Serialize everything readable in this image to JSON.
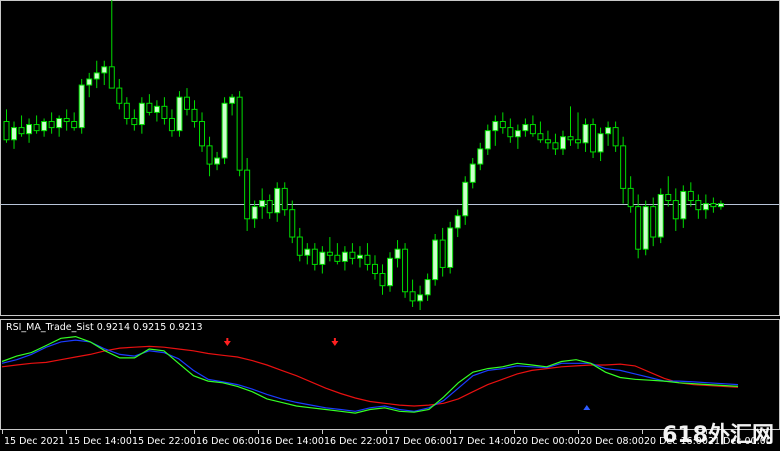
{
  "chart_data": [
    {
      "type": "candlestick",
      "title": "",
      "colors": {
        "background": "#000000",
        "bull": "#ccffcc",
        "bear": "#000000",
        "wick": "#00dd00",
        "grid_line": "#b8c4d8",
        "frame": "#c8c8c8"
      },
      "ylim": [
        0.0,
        1.0
      ],
      "reference_line_value": 0.35,
      "candles": [
        [
          0.62,
          0.66,
          0.55,
          0.56
        ],
        [
          0.56,
          0.62,
          0.53,
          0.6
        ],
        [
          0.6,
          0.64,
          0.57,
          0.58
        ],
        [
          0.58,
          0.63,
          0.55,
          0.61
        ],
        [
          0.61,
          0.64,
          0.58,
          0.59
        ],
        [
          0.59,
          0.63,
          0.57,
          0.62
        ],
        [
          0.62,
          0.65,
          0.58,
          0.6
        ],
        [
          0.6,
          0.64,
          0.57,
          0.63
        ],
        [
          0.63,
          0.66,
          0.59,
          0.62
        ],
        [
          0.62,
          0.65,
          0.59,
          0.6
        ],
        [
          0.6,
          0.76,
          0.58,
          0.74
        ],
        [
          0.74,
          0.78,
          0.7,
          0.76
        ],
        [
          0.76,
          0.82,
          0.73,
          0.78
        ],
        [
          0.78,
          0.82,
          0.74,
          0.8
        ],
        [
          0.8,
          1.02,
          0.77,
          0.73
        ],
        [
          0.73,
          0.76,
          0.66,
          0.68
        ],
        [
          0.68,
          0.7,
          0.61,
          0.63
        ],
        [
          0.63,
          0.66,
          0.59,
          0.61
        ],
        [
          0.61,
          0.7,
          0.58,
          0.68
        ],
        [
          0.68,
          0.71,
          0.64,
          0.65
        ],
        [
          0.65,
          0.69,
          0.62,
          0.67
        ],
        [
          0.67,
          0.7,
          0.61,
          0.63
        ],
        [
          0.63,
          0.66,
          0.57,
          0.59
        ],
        [
          0.59,
          0.72,
          0.57,
          0.7
        ],
        [
          0.7,
          0.73,
          0.64,
          0.66
        ],
        [
          0.66,
          0.69,
          0.6,
          0.62
        ],
        [
          0.62,
          0.65,
          0.52,
          0.54
        ],
        [
          0.54,
          0.57,
          0.44,
          0.48
        ],
        [
          0.48,
          0.52,
          0.46,
          0.5
        ],
        [
          0.5,
          0.7,
          0.48,
          0.68
        ],
        [
          0.68,
          0.71,
          0.64,
          0.7
        ],
        [
          0.7,
          0.72,
          0.44,
          0.46
        ],
        [
          0.46,
          0.5,
          0.26,
          0.3
        ],
        [
          0.3,
          0.36,
          0.27,
          0.34
        ],
        [
          0.34,
          0.4,
          0.3,
          0.36
        ],
        [
          0.36,
          0.38,
          0.3,
          0.32
        ],
        [
          0.32,
          0.42,
          0.29,
          0.4
        ],
        [
          0.4,
          0.42,
          0.31,
          0.33
        ],
        [
          0.33,
          0.36,
          0.22,
          0.24
        ],
        [
          0.24,
          0.27,
          0.16,
          0.18
        ],
        [
          0.18,
          0.22,
          0.15,
          0.2
        ],
        [
          0.2,
          0.22,
          0.13,
          0.15
        ],
        [
          0.15,
          0.21,
          0.12,
          0.19
        ],
        [
          0.19,
          0.24,
          0.16,
          0.18
        ],
        [
          0.18,
          0.22,
          0.15,
          0.16
        ],
        [
          0.16,
          0.21,
          0.13,
          0.19
        ],
        [
          0.19,
          0.22,
          0.15,
          0.17
        ],
        [
          0.17,
          0.21,
          0.14,
          0.18
        ],
        [
          0.18,
          0.22,
          0.13,
          0.15
        ],
        [
          0.15,
          0.18,
          0.1,
          0.12
        ],
        [
          0.12,
          0.15,
          0.05,
          0.08
        ],
        [
          0.08,
          0.19,
          0.06,
          0.17
        ],
        [
          0.17,
          0.23,
          0.14,
          0.2
        ],
        [
          0.2,
          0.22,
          0.04,
          0.06
        ],
        [
          0.06,
          0.1,
          0.01,
          0.03
        ],
        [
          0.03,
          0.08,
          0.0,
          0.05
        ],
        [
          0.05,
          0.12,
          0.03,
          0.1
        ],
        [
          0.1,
          0.25,
          0.08,
          0.23
        ],
        [
          0.23,
          0.27,
          0.11,
          0.14
        ],
        [
          0.14,
          0.29,
          0.12,
          0.27
        ],
        [
          0.27,
          0.33,
          0.24,
          0.31
        ],
        [
          0.31,
          0.44,
          0.28,
          0.42
        ],
        [
          0.42,
          0.5,
          0.4,
          0.48
        ],
        [
          0.48,
          0.55,
          0.46,
          0.53
        ],
        [
          0.53,
          0.61,
          0.51,
          0.59
        ],
        [
          0.59,
          0.64,
          0.54,
          0.62
        ],
        [
          0.62,
          0.65,
          0.58,
          0.6
        ],
        [
          0.6,
          0.63,
          0.55,
          0.57
        ],
        [
          0.57,
          0.61,
          0.53,
          0.59
        ],
        [
          0.59,
          0.63,
          0.57,
          0.61
        ],
        [
          0.61,
          0.64,
          0.57,
          0.58
        ],
        [
          0.58,
          0.62,
          0.55,
          0.56
        ],
        [
          0.56,
          0.59,
          0.53,
          0.55
        ],
        [
          0.55,
          0.58,
          0.51,
          0.53
        ],
        [
          0.53,
          0.59,
          0.51,
          0.57
        ],
        [
          0.57,
          0.67,
          0.54,
          0.56
        ],
        [
          0.56,
          0.65,
          0.53,
          0.55
        ],
        [
          0.55,
          0.63,
          0.52,
          0.61
        ],
        [
          0.61,
          0.63,
          0.5,
          0.52
        ],
        [
          0.52,
          0.6,
          0.49,
          0.58
        ],
        [
          0.58,
          0.62,
          0.54,
          0.6
        ],
        [
          0.6,
          0.62,
          0.52,
          0.54
        ],
        [
          0.54,
          0.57,
          0.35,
          0.4
        ],
        [
          0.4,
          0.44,
          0.32,
          0.34
        ],
        [
          0.34,
          0.38,
          0.17,
          0.2
        ],
        [
          0.2,
          0.36,
          0.18,
          0.34
        ],
        [
          0.34,
          0.37,
          0.21,
          0.24
        ],
        [
          0.24,
          0.4,
          0.22,
          0.38
        ],
        [
          0.38,
          0.44,
          0.34,
          0.36
        ],
        [
          0.36,
          0.4,
          0.26,
          0.3
        ],
        [
          0.3,
          0.41,
          0.27,
          0.39
        ],
        [
          0.39,
          0.42,
          0.34,
          0.36
        ],
        [
          0.36,
          0.38,
          0.3,
          0.33
        ],
        [
          0.33,
          0.38,
          0.3,
          0.35
        ],
        [
          0.35,
          0.37,
          0.32,
          0.34
        ],
        [
          0.34,
          0.36,
          0.33,
          0.35
        ]
      ]
    },
    {
      "type": "line",
      "indicator_label": "RSI_MA_Trade_Sist 0.9214 0.9215 0.9213",
      "ylim": [
        0.0,
        1.0
      ],
      "x_tick_labels": [
        "15 Dec 2021",
        "15 Dec 14:00",
        "15 Dec 22:00",
        "16 Dec 06:00",
        "16 Dec 14:00",
        "16 Dec 22:00",
        "17 Dec 06:00",
        "17 Dec 14:00",
        "20 Dec 00:00",
        "20 Dec 08:00",
        "20 Dec 16:00",
        "21 Dec 00:00"
      ],
      "series": [
        {
          "name": "",
          "color": "#e81010",
          "values": [
            0.62,
            0.64,
            0.66,
            0.67,
            0.7,
            0.73,
            0.76,
            0.8,
            0.83,
            0.84,
            0.85,
            0.84,
            0.82,
            0.8,
            0.77,
            0.75,
            0.73,
            0.69,
            0.64,
            0.58,
            0.52,
            0.45,
            0.38,
            0.32,
            0.27,
            0.23,
            0.21,
            0.19,
            0.18,
            0.19,
            0.21,
            0.26,
            0.34,
            0.42,
            0.48,
            0.54,
            0.58,
            0.6,
            0.62,
            0.63,
            0.64,
            0.64,
            0.65,
            0.63,
            0.56,
            0.49,
            0.44,
            0.42,
            0.41,
            0.4,
            0.39
          ]
        },
        {
          "name": "",
          "color": "#1a3cff",
          "values": [
            0.66,
            0.7,
            0.76,
            0.84,
            0.9,
            0.92,
            0.9,
            0.82,
            0.76,
            0.74,
            0.8,
            0.78,
            0.71,
            0.58,
            0.48,
            0.45,
            0.42,
            0.37,
            0.31,
            0.26,
            0.22,
            0.19,
            0.16,
            0.14,
            0.12,
            0.16,
            0.18,
            0.14,
            0.12,
            0.16,
            0.24,
            0.38,
            0.52,
            0.58,
            0.6,
            0.63,
            0.62,
            0.61,
            0.66,
            0.66,
            0.66,
            0.6,
            0.58,
            0.54,
            0.5,
            0.46,
            0.46,
            0.45,
            0.44,
            0.43,
            0.42
          ]
        },
        {
          "name": "",
          "color": "#34ff24",
          "values": [
            0.68,
            0.74,
            0.78,
            0.86,
            0.94,
            0.96,
            0.9,
            0.8,
            0.72,
            0.72,
            0.82,
            0.8,
            0.66,
            0.52,
            0.46,
            0.44,
            0.4,
            0.34,
            0.26,
            0.22,
            0.18,
            0.16,
            0.14,
            0.12,
            0.1,
            0.14,
            0.16,
            0.12,
            0.11,
            0.14,
            0.28,
            0.44,
            0.56,
            0.6,
            0.62,
            0.66,
            0.64,
            0.62,
            0.68,
            0.7,
            0.66,
            0.56,
            0.5,
            0.48,
            0.47,
            0.46,
            0.44,
            0.43,
            0.42,
            0.41,
            0.4
          ]
        }
      ],
      "signals": [
        {
          "type": "sell",
          "color": "#ff2020",
          "x": 29.7
        },
        {
          "type": "sell",
          "color": "#ff2020",
          "x": 44.0
        },
        {
          "type": "sell",
          "color": "#ff2020",
          "x": 104.6
        },
        {
          "type": "buy",
          "color": "#2d5bff",
          "x": 77.5
        }
      ]
    }
  ],
  "watermark": "618外汇网"
}
